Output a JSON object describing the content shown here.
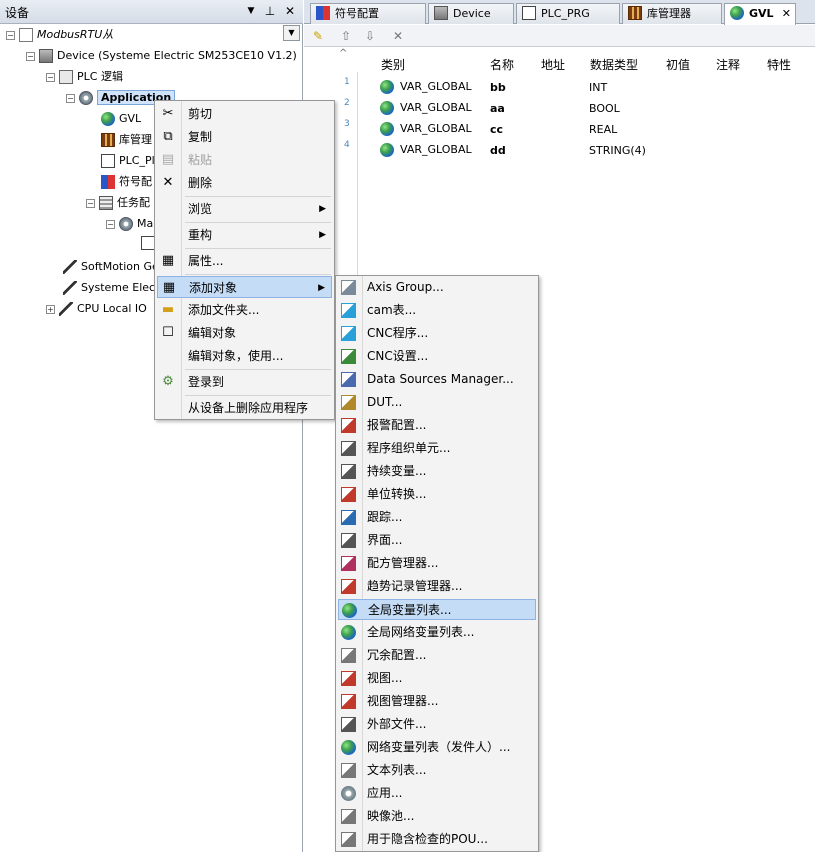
{
  "left_pane": {
    "title": "设备",
    "pin_glyph": "▼",
    "dock_glyph": "ㅁ",
    "close_glyph": "✕",
    "tree": {
      "project": "ModbusRTU从",
      "device": "Device (Systeme Electric SM253CE10 V1.2)",
      "plc_logic": "PLC 逻辑",
      "application": "Application",
      "gvl": "GVL",
      "library_manager_partial": "库管理",
      "plc_prg_partial": "PLC_Pl",
      "symbol_config_partial": "符号配",
      "task_config_partial": "任务配",
      "main_task_partial": "Ma",
      "softmotion_partial": "SoftMotion Gen",
      "systeme_electric_partial": "Systeme Electr",
      "cpu_local_io": "CPU Local IO"
    }
  },
  "tabs": [
    {
      "label": "符号配置",
      "icon": "symbol-config-icon"
    },
    {
      "label": "Device",
      "icon": "device-icon"
    },
    {
      "label": "PLC_PRG",
      "icon": "program-icon"
    },
    {
      "label": "库管理器",
      "icon": "library-icon"
    },
    {
      "label": "GVL",
      "icon": "globe-icon",
      "active": true
    }
  ],
  "tab_close": "✕",
  "toolbar": {
    "add_icon": "add-var-icon",
    "up": "⇧",
    "down": "⇩",
    "delete": "✕"
  },
  "gvl_table": {
    "headers": [
      "类别",
      "名称",
      "地址",
      "数据类型",
      "初值",
      "注释",
      "特性"
    ],
    "rows": [
      {
        "num": "1",
        "category": "VAR_GLOBAL",
        "name": "bb",
        "address": "",
        "type": "INT"
      },
      {
        "num": "2",
        "category": "VAR_GLOBAL",
        "name": "aa",
        "address": "",
        "type": "BOOL"
      },
      {
        "num": "3",
        "category": "VAR_GLOBAL",
        "name": "cc",
        "address": "",
        "type": "REAL"
      },
      {
        "num": "4",
        "category": "VAR_GLOBAL",
        "name": "dd",
        "address": "",
        "type": "STRING(4)"
      }
    ]
  },
  "context_menu": {
    "items": [
      {
        "label": "剪切",
        "icon": "scissors-icon"
      },
      {
        "label": "复制",
        "icon": "copy-icon"
      },
      {
        "label": "粘贴",
        "icon": "paste-icon",
        "disabled": true
      },
      {
        "label": "删除",
        "icon": "delete-icon"
      },
      {
        "label": "浏览",
        "submenu": true
      },
      {
        "label": "重构",
        "submenu": true
      },
      {
        "label": "属性...",
        "icon": "properties-icon"
      },
      {
        "label": "添加对象",
        "icon": "add-object-icon",
        "submenu": true,
        "highlighted": true
      },
      {
        "label": "添加文件夹...",
        "icon": "folder-icon"
      },
      {
        "label": "编辑对象",
        "icon": "edit-icon"
      },
      {
        "label": "编辑对象，使用...",
        "icon": ""
      },
      {
        "label": "登录到",
        "icon": "login-icon"
      },
      {
        "label": "从设备上删除应用程序",
        "icon": ""
      }
    ],
    "submenu_arrow": "▶"
  },
  "submenu": {
    "items": [
      {
        "label": "Axis Group...",
        "icon": "axis-group-icon"
      },
      {
        "label": "cam表...",
        "icon": "cam-table-icon"
      },
      {
        "label": "CNC程序...",
        "icon": "cnc-program-icon"
      },
      {
        "label": "CNC设置...",
        "icon": "cnc-settings-icon"
      },
      {
        "label": "Data Sources Manager...",
        "icon": "data-sources-icon"
      },
      {
        "label": "DUT...",
        "icon": "dut-icon"
      },
      {
        "label": "报警配置...",
        "icon": "alarm-config-icon"
      },
      {
        "label": "程序组织单元...",
        "icon": "pou-icon"
      },
      {
        "label": "持续变量...",
        "icon": "persistent-var-icon"
      },
      {
        "label": "单位转换...",
        "icon": "unit-conversion-icon"
      },
      {
        "label": "跟踪...",
        "icon": "trace-icon"
      },
      {
        "label": "界面...",
        "icon": "interface-icon"
      },
      {
        "label": "配方管理器...",
        "icon": "recipe-manager-icon"
      },
      {
        "label": "趋势记录管理器...",
        "icon": "trend-manager-icon"
      },
      {
        "label": "全局变量列表...",
        "icon": "globe-icon",
        "highlighted": true
      },
      {
        "label": "全局网络变量列表...",
        "icon": "network-globe-icon"
      },
      {
        "label": "冗余配置...",
        "icon": "redundancy-icon"
      },
      {
        "label": "视图...",
        "icon": "visualization-icon"
      },
      {
        "label": "视图管理器...",
        "icon": "visualization-manager-icon"
      },
      {
        "label": "外部文件...",
        "icon": "external-file-icon"
      },
      {
        "label": "网络变量列表（发件人）...",
        "icon": "network-sender-icon"
      },
      {
        "label": "文本列表...",
        "icon": "text-list-icon"
      },
      {
        "label": "应用...",
        "icon": "application-icon"
      },
      {
        "label": "映像池...",
        "icon": "image-pool-icon"
      },
      {
        "label": "用于隐含检查的POU...",
        "icon": "implicit-check-icon"
      }
    ]
  }
}
